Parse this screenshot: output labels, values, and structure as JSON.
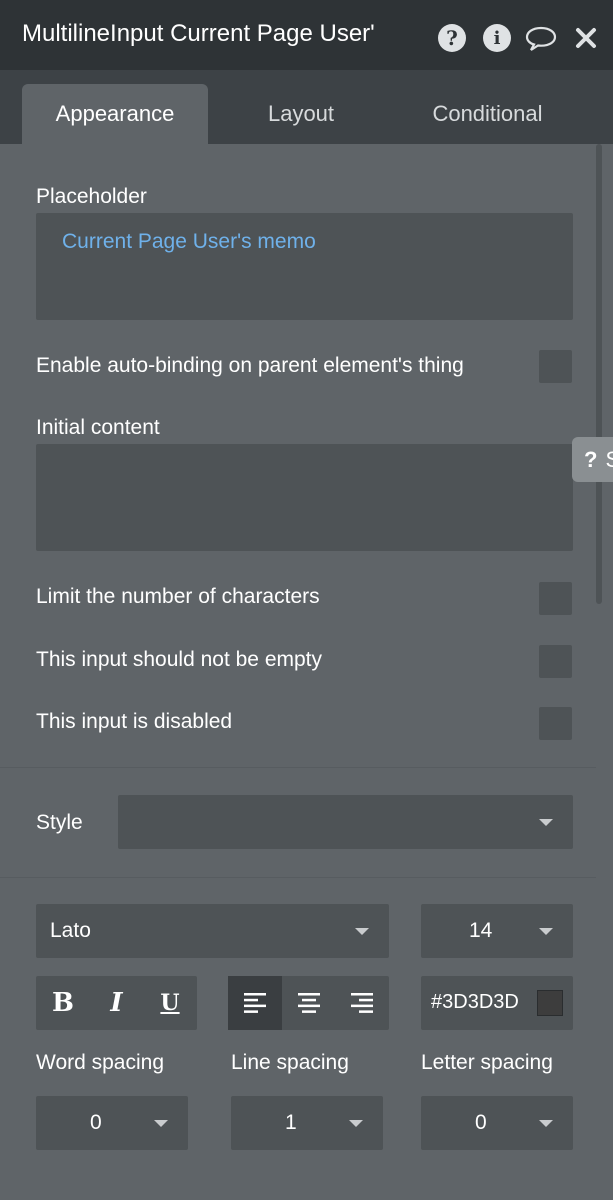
{
  "header": {
    "title": "MultilineInput Current Page User'",
    "icons": [
      "help-icon",
      "info-icon",
      "comment-icon",
      "close-icon"
    ]
  },
  "tabs": [
    "Appearance",
    "Layout",
    "Conditional"
  ],
  "active_tab": "Appearance",
  "side_help": {
    "glyph": "?",
    "partial_text": "S"
  },
  "placeholder": {
    "label": "Placeholder",
    "value": "Current Page User's memo"
  },
  "auto_binding": {
    "label": "Enable auto-binding on parent element's thing"
  },
  "initial_content": {
    "label": "Initial content",
    "value": ""
  },
  "checkboxes": [
    {
      "label": "Limit the number of characters"
    },
    {
      "label": "This input should not be empty"
    },
    {
      "label": "This input is disabled"
    }
  ],
  "style": {
    "label": "Style",
    "value": ""
  },
  "font": {
    "family": "Lato",
    "size": "14",
    "bold": "B",
    "italic": "I",
    "underline": "U",
    "alignments": [
      "align-left",
      "align-center",
      "align-right"
    ],
    "active_alignment": "align-left",
    "color_hex": "#3D3D3D",
    "color_swatch": "#3d3d3d"
  },
  "spacing": {
    "word_label": "Word spacing",
    "word_value": "0",
    "line_label": "Line spacing",
    "line_value": "1",
    "letter_label": "Letter spacing",
    "letter_value": "0"
  },
  "colors": {
    "title_bar": "#2e3336",
    "panel": "#5f6468",
    "field": "#4e5356",
    "placeholder_text": "#6fb1ea"
  }
}
